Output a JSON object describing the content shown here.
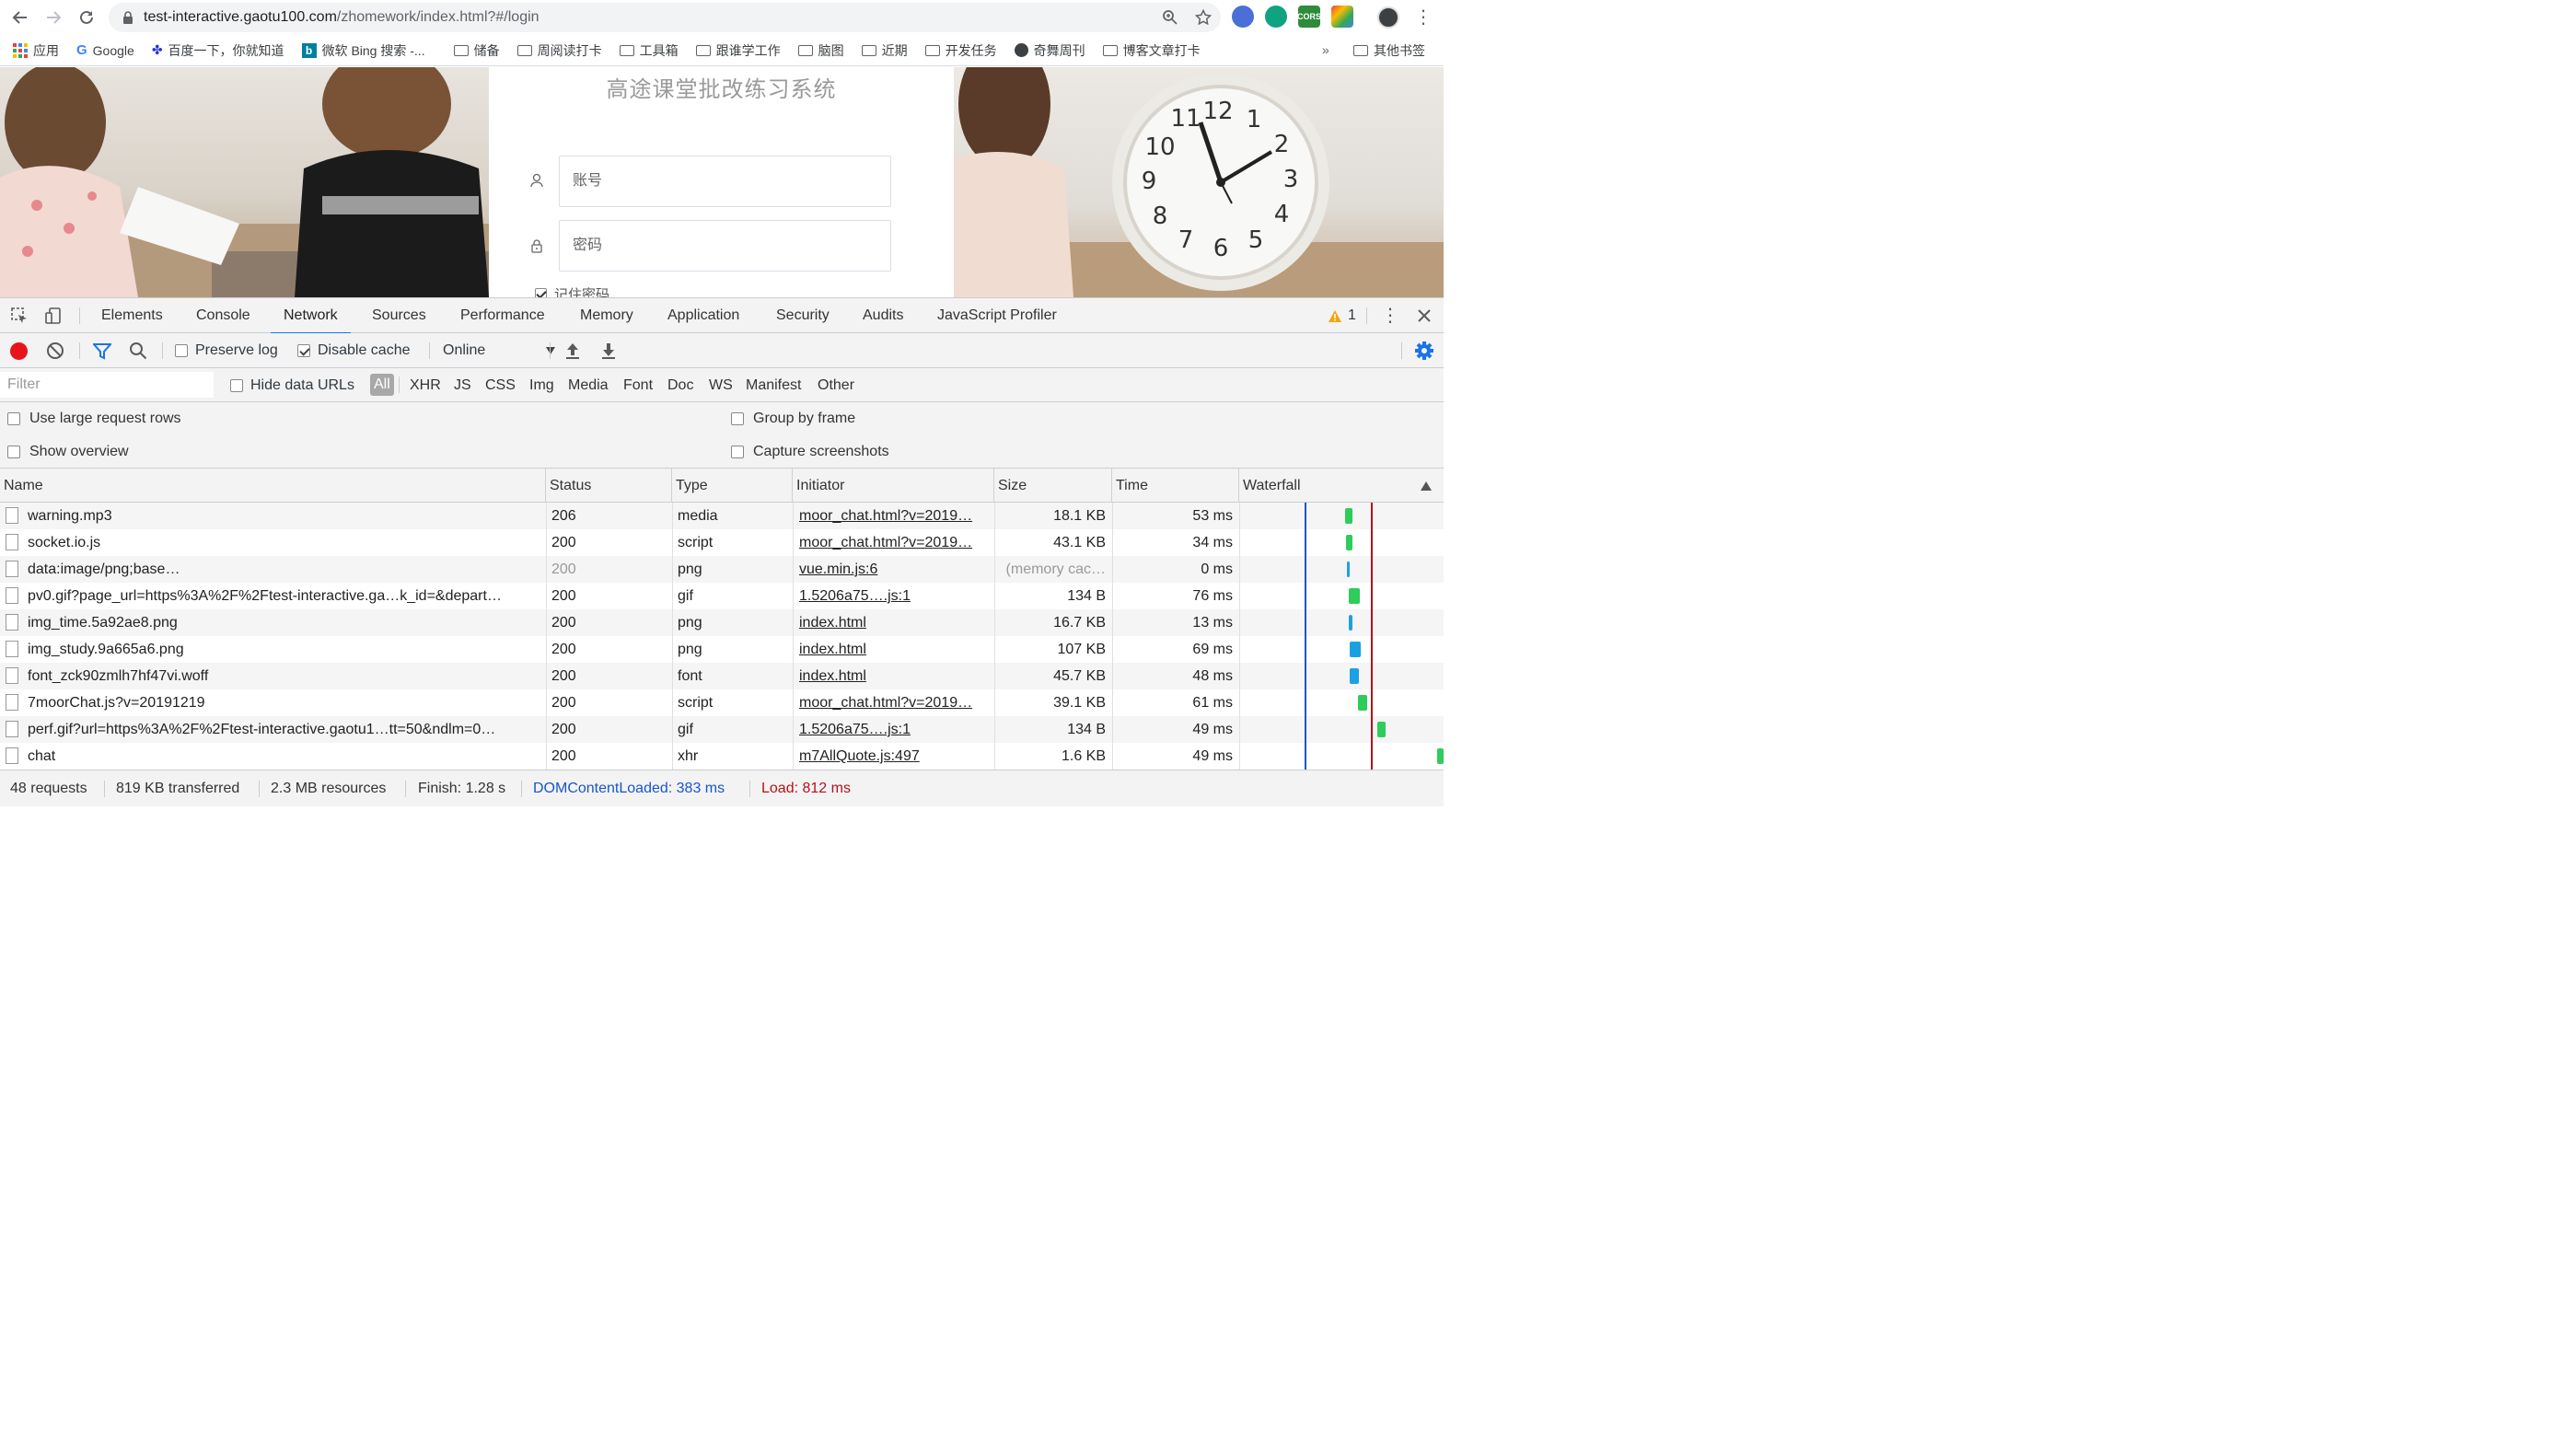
{
  "browser": {
    "url_host": "test-interactive.gaotu100.com",
    "url_path": "/zhomework/index.html?#/login",
    "bookmarks": [
      "应用",
      "Google",
      "百度一下，你就知道",
      "微软 Bing 搜索 -...",
      "储备",
      "周阅读打卡",
      "工具箱",
      "跟谁学工作",
      "脑图",
      "近期",
      "开发任务",
      "奇舞周刊",
      "博客文章打卡"
    ],
    "bookmarks_more": "»",
    "other_bookmarks": "其他书签"
  },
  "page": {
    "title": "高途课堂批改练习系统",
    "account_placeholder": "账号",
    "password_placeholder": "密码",
    "remember_label": "记住密码"
  },
  "devtools": {
    "tabs": [
      "Elements",
      "Console",
      "Network",
      "Sources",
      "Performance",
      "Memory",
      "Application",
      "Security",
      "Audits",
      "JavaScript Profiler"
    ],
    "active_tab": "Network",
    "warning_count": "1",
    "toolbar": {
      "preserve_log": "Preserve log",
      "disable_cache": "Disable cache",
      "throttle": "Online"
    },
    "filter": {
      "placeholder": "Filter",
      "hide_data_urls": "Hide data URLs",
      "types": [
        "All",
        "XHR",
        "JS",
        "CSS",
        "Img",
        "Media",
        "Font",
        "Doc",
        "WS",
        "Manifest",
        "Other"
      ]
    },
    "settings": {
      "large_rows": "Use large request rows",
      "show_overview": "Show overview",
      "group_by_frame": "Group by frame",
      "capture_screenshots": "Capture screenshots"
    },
    "columns": [
      "Name",
      "Status",
      "Type",
      "Initiator",
      "Size",
      "Time",
      "Waterfall"
    ],
    "requests": [
      {
        "name": "warning.mp3",
        "status": "206",
        "type": "media",
        "initiator": "moor_chat.html?v=2019…",
        "size": "18.1 KB",
        "time": "53 ms"
      },
      {
        "name": "socket.io.js",
        "status": "200",
        "type": "script",
        "initiator": "moor_chat.html?v=2019…",
        "size": "43.1 KB",
        "time": "34 ms"
      },
      {
        "name": "data:image/png;base…",
        "status": "200",
        "type": "png",
        "initiator": "vue.min.js:6",
        "size": "(memory cac…",
        "time": "0 ms"
      },
      {
        "name": "pv0.gif?page_url=https%3A%2F%2Ftest-interactive.ga…k_id=&depart…",
        "status": "200",
        "type": "gif",
        "initiator": "1.5206a75….js:1",
        "size": "134 B",
        "time": "76 ms"
      },
      {
        "name": "img_time.5a92ae8.png",
        "status": "200",
        "type": "png",
        "initiator": "index.html",
        "size": "16.7 KB",
        "time": "13 ms"
      },
      {
        "name": "img_study.9a665a6.png",
        "status": "200",
        "type": "png",
        "initiator": "index.html",
        "size": "107 KB",
        "time": "69 ms"
      },
      {
        "name": "font_zck90zmlh7hf47vi.woff",
        "status": "200",
        "type": "font",
        "initiator": "index.html",
        "size": "45.7 KB",
        "time": "48 ms"
      },
      {
        "name": "7moorChat.js?v=20191219",
        "status": "200",
        "type": "script",
        "initiator": "moor_chat.html?v=2019…",
        "size": "39.1 KB",
        "time": "61 ms"
      },
      {
        "name": "perf.gif?url=https%3A%2F%2Ftest-interactive.gaotu1…tt=50&ndlm=0…",
        "status": "200",
        "type": "gif",
        "initiator": "1.5206a75….js:1",
        "size": "134 B",
        "time": "49 ms"
      },
      {
        "name": "chat",
        "status": "200",
        "type": "xhr",
        "initiator": "m7AllQuote.js:497",
        "size": "1.6 KB",
        "time": "49 ms"
      }
    ],
    "summary": {
      "requests": "48 requests",
      "transferred": "819 KB transferred",
      "resources": "2.3 MB resources",
      "finish": "Finish: 1.28 s",
      "dom_loaded": "DOMContentLoaded: 383 ms",
      "load": "Load: 812 ms"
    },
    "colors": {
      "accent": "#1a73e8",
      "dom_line": "#1a55c9",
      "load_line": "#b5121b",
      "wf_green": "#2ecc5a",
      "wf_blue": "#1ba1e2",
      "record": "#e8141a"
    }
  }
}
